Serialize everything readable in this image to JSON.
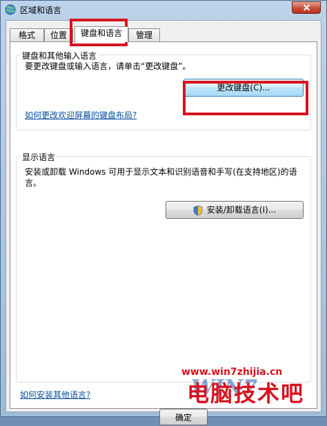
{
  "window": {
    "title": "区域和语言"
  },
  "tabs": [
    {
      "label": "格式"
    },
    {
      "label": "位置"
    },
    {
      "label": "键盘和语言"
    },
    {
      "label": "管理"
    }
  ],
  "keyboard_group": {
    "label": "键盘和其他输入语言",
    "description": "要更改键盘或输入语言，请单击“更改键盘”。",
    "change_button": "更改键盘(C)...",
    "link": "如何更改欢迎屏幕的键盘布局?"
  },
  "display_group": {
    "label": "显示语言",
    "description": "安装或卸载 Windows 可用于显示文本和识别语音和手写(在支持地区)的语言。",
    "install_button": "安装/卸载语言(I)..."
  },
  "footer": {
    "link": "如何安装其他语言?",
    "ok_button": "确定"
  },
  "watermark": {
    "url": "www.win7zhijia.cn",
    "logo": "电脑技术吧",
    "brand": "WIN7"
  },
  "colors": {
    "highlight": "#d8121e",
    "link": "#0b4fa0"
  }
}
